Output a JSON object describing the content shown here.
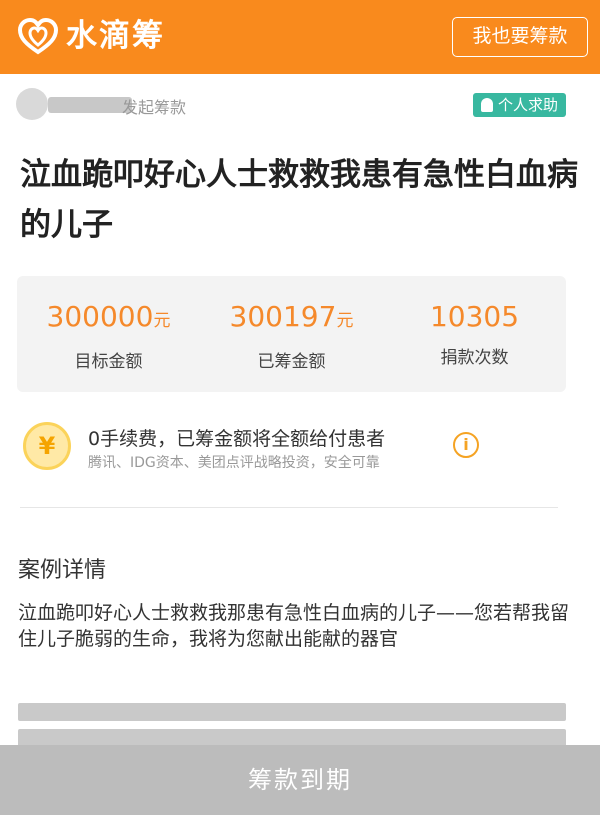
{
  "header": {
    "brand_name": "水滴筹",
    "start_button_label": "我也要筹款",
    "brand_color": "#f98a1d"
  },
  "initiator": {
    "suffix": "发起筹款",
    "tag_label": "个人求助",
    "tag_color": "#38b8a0"
  },
  "case": {
    "title": "泣血跪叩好心人士救救我患有急性白血病的儿子"
  },
  "stats": [
    {
      "value": "300000",
      "unit": "元",
      "label": "目标金额"
    },
    {
      "value": "300197",
      "unit": "元",
      "label": "已筹金额"
    },
    {
      "value": "10305",
      "unit": "",
      "label": "捐款次数"
    }
  ],
  "fee": {
    "coin_symbol": "¥",
    "title": "0手续费，已筹金额将全额给付患者",
    "subtitle": "腾讯、IDG资本、美团点评战略投资，安全可靠",
    "info_symbol": "i"
  },
  "details": {
    "section_title": "案例详情",
    "text": "泣血跪叩好心人士救救我那患有急性白血病的儿子——您若帮我留住儿子脆弱的生命，我将为您献出能献的器官"
  },
  "footer": {
    "button_label": "筹款到期"
  },
  "icons": {
    "logo": "water-drop-heart-icon",
    "tag": "person-icon",
    "coin": "yuan-coin-icon",
    "info": "info-icon"
  }
}
